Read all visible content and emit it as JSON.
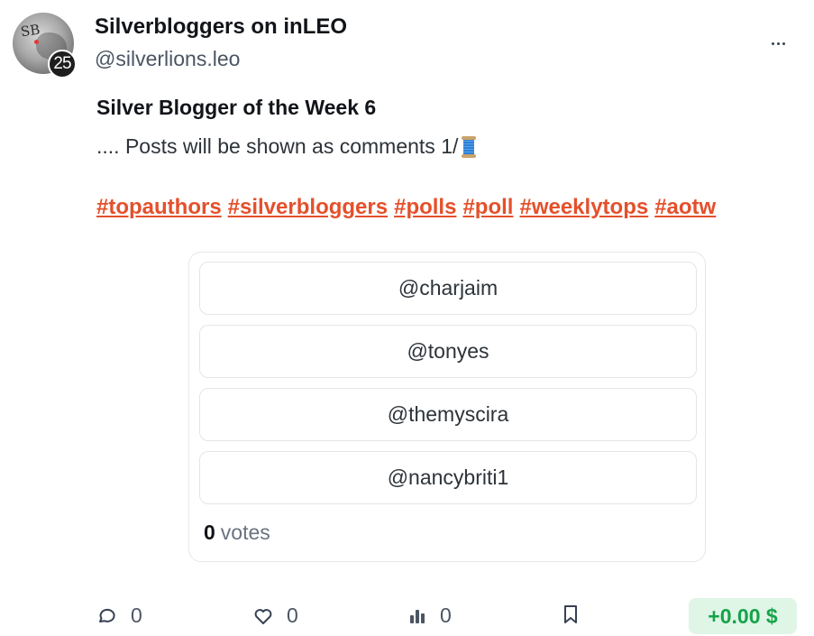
{
  "author": {
    "display_name": "Silverbloggers on inLEO",
    "handle": "@silverlions.leo",
    "reputation": "25",
    "avatar_text": "SB"
  },
  "post": {
    "title": "Silver Blogger of the Week 6",
    "body": ".... Posts will be shown as comments 1/",
    "tags": [
      "#topauthors",
      "#silverbloggers",
      "#polls",
      "#poll",
      "#weeklytops",
      "#aotw"
    ]
  },
  "poll": {
    "options": [
      "@charjaim",
      "@tonyes",
      "@themyscira",
      "@nancybriti1"
    ],
    "vote_count": "0",
    "votes_label": "votes"
  },
  "actions": {
    "comments": "0",
    "likes": "0",
    "rethreads": "0",
    "payout": "+0.00 $"
  },
  "colors": {
    "tag": "#e4502b",
    "payout_text": "#16a34a",
    "payout_bg": "#dff5e6"
  }
}
